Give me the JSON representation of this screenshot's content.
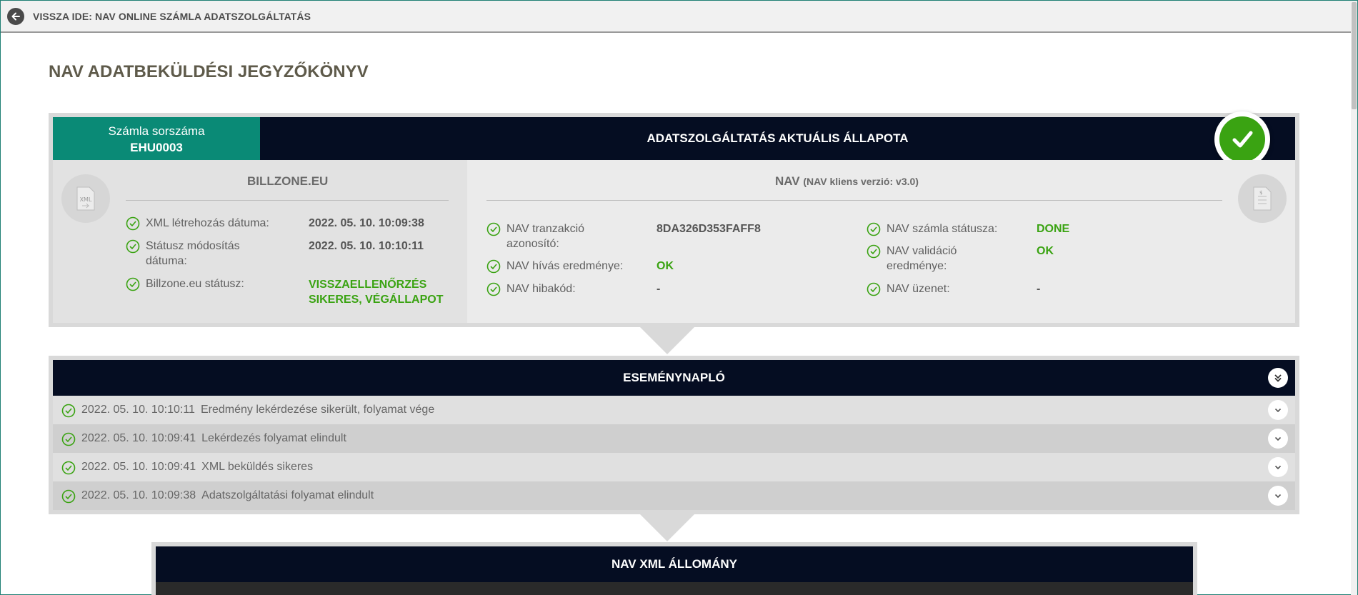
{
  "topbar": {
    "back_label": "VISSZA IDE: NAV ONLINE SZÁMLA ADATSZOLGÁLTATÁS"
  },
  "page_title": "NAV ADATBEKÜLDÉSI JEGYZŐKÖNYV",
  "status_card": {
    "invoice_label": "Számla sorszáma",
    "invoice_number": "EHU0003",
    "status_title": "ADATSZOLGÁLTATÁS AKTUÁLIS ÁLLAPOTA",
    "billzone": {
      "title": "BILLZONE.EU",
      "rows": [
        {
          "label": "XML létrehozás dátuma:",
          "value": "2022. 05. 10. 10:09:38"
        },
        {
          "label1": "Státusz módosítás",
          "label2": "dátuma:",
          "value": "2022. 05. 10. 10:10:11"
        },
        {
          "label": "Billzone.eu státusz:",
          "value1": "VISSZAELLENŐRZÉS",
          "value2": "SIKERES, VÉGÁLLAPOT"
        }
      ]
    },
    "nav": {
      "title": "NAV",
      "subtitle": "(NAV kliens verzió: v3.0)",
      "left_rows": [
        {
          "label1": "NAV tranzakció",
          "label2": "azonosító:",
          "value": "8DA326D353FAFF8"
        },
        {
          "label": "NAV hívás eredménye:",
          "value": "OK"
        },
        {
          "label": "NAV hibakód:",
          "value": "-"
        }
      ],
      "right_rows": [
        {
          "label": "NAV számla státusza:",
          "value": "DONE"
        },
        {
          "label1": "NAV validáció",
          "label2": "eredménye:",
          "value": "OK"
        },
        {
          "label": "NAV üzenet:",
          "value": "-"
        }
      ]
    }
  },
  "event_log": {
    "title": "ESEMÉNYNAPLÓ",
    "entries": [
      {
        "time": "2022. 05. 10. 10:10:11",
        "text": "Eredmény lekérdezése sikerült, folyamat vége"
      },
      {
        "time": "2022. 05. 10. 10:09:41",
        "text": "Lekérdezés folyamat elindult"
      },
      {
        "time": "2022. 05. 10. 10:09:41",
        "text": "XML beküldés sikeres"
      },
      {
        "time": "2022. 05. 10. 10:09:38",
        "text": "Adatszolgáltatási folyamat elindult"
      }
    ]
  },
  "xml_section": {
    "title": "NAV XML ÁLLOMÁNY"
  },
  "colors": {
    "accent_teal": "#0a8a76",
    "navy": "#050d22",
    "success_green": "#3aa312"
  },
  "icons": [
    "back-arrow-icon",
    "check-circle-icon",
    "xml-file-icon",
    "invoice-doc-icon",
    "chevron-down-icon",
    "double-chevron-down-icon",
    "success-check-icon"
  ]
}
